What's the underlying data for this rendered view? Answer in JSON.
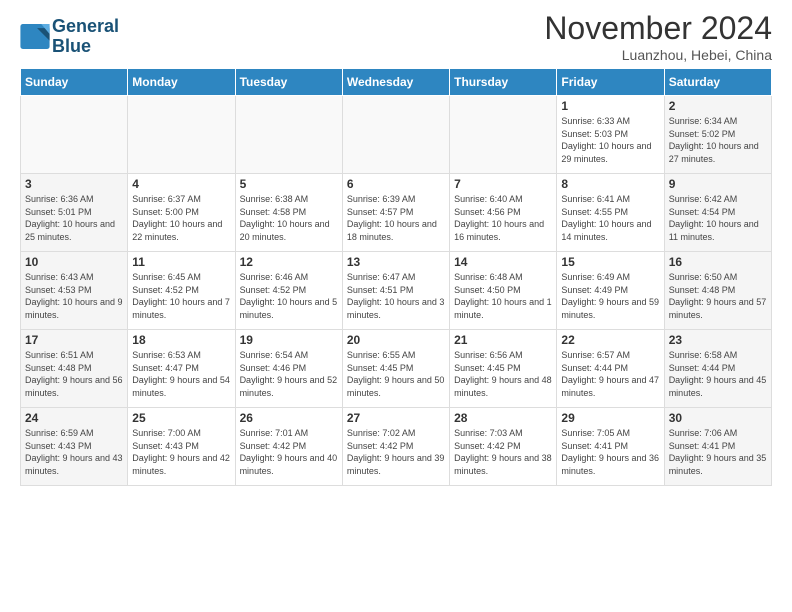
{
  "header": {
    "logo_line1": "General",
    "logo_line2": "Blue",
    "month_title": "November 2024",
    "location": "Luanzhou, Hebei, China"
  },
  "days_of_week": [
    "Sunday",
    "Monday",
    "Tuesday",
    "Wednesday",
    "Thursday",
    "Friday",
    "Saturday"
  ],
  "weeks": [
    [
      {
        "day": "",
        "info": "",
        "empty": true
      },
      {
        "day": "",
        "info": "",
        "empty": true
      },
      {
        "day": "",
        "info": "",
        "empty": true
      },
      {
        "day": "",
        "info": "",
        "empty": true
      },
      {
        "day": "",
        "info": "",
        "empty": true
      },
      {
        "day": "1",
        "info": "Sunrise: 6:33 AM\nSunset: 5:03 PM\nDaylight: 10 hours and 29 minutes."
      },
      {
        "day": "2",
        "info": "Sunrise: 6:34 AM\nSunset: 5:02 PM\nDaylight: 10 hours and 27 minutes."
      }
    ],
    [
      {
        "day": "3",
        "info": "Sunrise: 6:36 AM\nSunset: 5:01 PM\nDaylight: 10 hours and 25 minutes."
      },
      {
        "day": "4",
        "info": "Sunrise: 6:37 AM\nSunset: 5:00 PM\nDaylight: 10 hours and 22 minutes."
      },
      {
        "day": "5",
        "info": "Sunrise: 6:38 AM\nSunset: 4:58 PM\nDaylight: 10 hours and 20 minutes."
      },
      {
        "day": "6",
        "info": "Sunrise: 6:39 AM\nSunset: 4:57 PM\nDaylight: 10 hours and 18 minutes."
      },
      {
        "day": "7",
        "info": "Sunrise: 6:40 AM\nSunset: 4:56 PM\nDaylight: 10 hours and 16 minutes."
      },
      {
        "day": "8",
        "info": "Sunrise: 6:41 AM\nSunset: 4:55 PM\nDaylight: 10 hours and 14 minutes."
      },
      {
        "day": "9",
        "info": "Sunrise: 6:42 AM\nSunset: 4:54 PM\nDaylight: 10 hours and 11 minutes."
      }
    ],
    [
      {
        "day": "10",
        "info": "Sunrise: 6:43 AM\nSunset: 4:53 PM\nDaylight: 10 hours and 9 minutes."
      },
      {
        "day": "11",
        "info": "Sunrise: 6:45 AM\nSunset: 4:52 PM\nDaylight: 10 hours and 7 minutes."
      },
      {
        "day": "12",
        "info": "Sunrise: 6:46 AM\nSunset: 4:52 PM\nDaylight: 10 hours and 5 minutes."
      },
      {
        "day": "13",
        "info": "Sunrise: 6:47 AM\nSunset: 4:51 PM\nDaylight: 10 hours and 3 minutes."
      },
      {
        "day": "14",
        "info": "Sunrise: 6:48 AM\nSunset: 4:50 PM\nDaylight: 10 hours and 1 minute."
      },
      {
        "day": "15",
        "info": "Sunrise: 6:49 AM\nSunset: 4:49 PM\nDaylight: 9 hours and 59 minutes."
      },
      {
        "day": "16",
        "info": "Sunrise: 6:50 AM\nSunset: 4:48 PM\nDaylight: 9 hours and 57 minutes."
      }
    ],
    [
      {
        "day": "17",
        "info": "Sunrise: 6:51 AM\nSunset: 4:48 PM\nDaylight: 9 hours and 56 minutes."
      },
      {
        "day": "18",
        "info": "Sunrise: 6:53 AM\nSunset: 4:47 PM\nDaylight: 9 hours and 54 minutes."
      },
      {
        "day": "19",
        "info": "Sunrise: 6:54 AM\nSunset: 4:46 PM\nDaylight: 9 hours and 52 minutes."
      },
      {
        "day": "20",
        "info": "Sunrise: 6:55 AM\nSunset: 4:45 PM\nDaylight: 9 hours and 50 minutes."
      },
      {
        "day": "21",
        "info": "Sunrise: 6:56 AM\nSunset: 4:45 PM\nDaylight: 9 hours and 48 minutes."
      },
      {
        "day": "22",
        "info": "Sunrise: 6:57 AM\nSunset: 4:44 PM\nDaylight: 9 hours and 47 minutes."
      },
      {
        "day": "23",
        "info": "Sunrise: 6:58 AM\nSunset: 4:44 PM\nDaylight: 9 hours and 45 minutes."
      }
    ],
    [
      {
        "day": "24",
        "info": "Sunrise: 6:59 AM\nSunset: 4:43 PM\nDaylight: 9 hours and 43 minutes."
      },
      {
        "day": "25",
        "info": "Sunrise: 7:00 AM\nSunset: 4:43 PM\nDaylight: 9 hours and 42 minutes."
      },
      {
        "day": "26",
        "info": "Sunrise: 7:01 AM\nSunset: 4:42 PM\nDaylight: 9 hours and 40 minutes."
      },
      {
        "day": "27",
        "info": "Sunrise: 7:02 AM\nSunset: 4:42 PM\nDaylight: 9 hours and 39 minutes."
      },
      {
        "day": "28",
        "info": "Sunrise: 7:03 AM\nSunset: 4:42 PM\nDaylight: 9 hours and 38 minutes."
      },
      {
        "day": "29",
        "info": "Sunrise: 7:05 AM\nSunset: 4:41 PM\nDaylight: 9 hours and 36 minutes."
      },
      {
        "day": "30",
        "info": "Sunrise: 7:06 AM\nSunset: 4:41 PM\nDaylight: 9 hours and 35 minutes."
      }
    ]
  ]
}
